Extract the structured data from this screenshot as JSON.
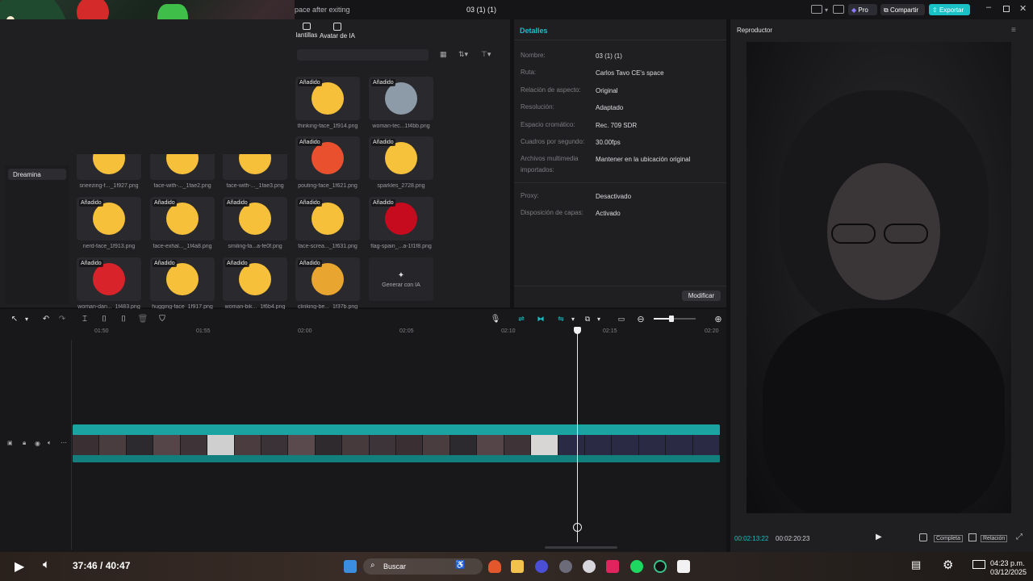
{
  "title_bar": {
    "left_text": "pace after exiting",
    "project_name": "03 (1) (1)",
    "pro_label": "Pro",
    "share_label": "Compartir",
    "export_label": "Exportar",
    "accent_color": "#19c0c6"
  },
  "media_panel": {
    "tabs": [
      {
        "label": "lantillas",
        "icon": "template-icon"
      },
      {
        "label": "Avatar de IA",
        "icon": "avatar-icon"
      }
    ],
    "sidebar": {
      "active_item": "Dreamina"
    },
    "badge_label": "Añadido",
    "items": [
      {
        "caption": "thinking-face_1f914.png",
        "icon": "thinking-face-icon",
        "color": "#f6c03a"
      },
      {
        "caption": "woman-tec...1f4bb.png",
        "icon": "woman-technologist-icon",
        "color": "#8d9aa8"
      },
      {
        "caption": "pouting-face_1f621.png",
        "icon": "pouting-face-icon",
        "color": "#e8502e"
      },
      {
        "caption": "sparkles_2728.png",
        "icon": "sparkles-icon",
        "color": "#f7c23b"
      },
      {
        "caption": "sneezing-f..._1f927.png",
        "icon": "sneezing-face-icon",
        "color": "#f6c03a"
      },
      {
        "caption": "face-with-..._1fae2.png",
        "icon": "face-with-hand-icon",
        "color": "#f6c03a"
      },
      {
        "caption": "face-with-..._1fae3.png",
        "icon": "face-peeking-icon",
        "color": "#f6c03a"
      },
      {
        "caption": "nerd-face_1f913.png",
        "icon": "nerd-face-icon",
        "color": "#f6c03a"
      },
      {
        "caption": "face-exhal..._1f4a8.png",
        "icon": "face-exhaling-icon",
        "color": "#f6c03a"
      },
      {
        "caption": "smiling-fa...a-fe0f.png",
        "icon": "smiling-face-icon",
        "color": "#f6c03a"
      },
      {
        "caption": "face-screa..._1f631.png",
        "icon": "face-screaming-icon",
        "color": "#f6c03a"
      },
      {
        "caption": "flag-spain_...a-1f1f8.png",
        "icon": "flag-spain-icon",
        "color": "#c60b1e"
      },
      {
        "caption": "woman-dan..._1f483.png",
        "icon": "woman-dancing-icon",
        "color": "#d8232a"
      },
      {
        "caption": "hugging-face_1f917.png",
        "icon": "hugging-face-icon",
        "color": "#f6c03a"
      },
      {
        "caption": "woman-bik..._1f6b4.png",
        "icon": "woman-biking-icon",
        "color": "#f6c03a"
      },
      {
        "caption": "clinking-be..._1f37b.png",
        "icon": "clinking-beer-icon",
        "color": "#e8a530"
      }
    ],
    "generate_label": "Generar con IA"
  },
  "details": {
    "title": "Detalles",
    "rows": [
      {
        "label": "Nombre:",
        "value": "03 (1) (1)"
      },
      {
        "label": "Ruta:",
        "value": "Carlos Tavo CE's space"
      },
      {
        "label": "Relación de aspecto:",
        "value": "Original"
      },
      {
        "label": "Resolución:",
        "value": "Adaptado"
      },
      {
        "label": "Espacio cromático:",
        "value": "Rec. 709 SDR"
      },
      {
        "label": "Cuadros por segundo:",
        "value": "30.00fps"
      },
      {
        "label": "Archivos multimedia importados:",
        "value": "Mantener en la ubicación original"
      },
      {
        "label": "Proxy:",
        "value": "Desactivado"
      },
      {
        "label": "Disposición de capas:",
        "value": "Activado"
      }
    ],
    "modify_label": "Modificar"
  },
  "player": {
    "title": "Reproductor",
    "current_time": "00:02:13:22",
    "total_time": "00:02:20:23",
    "full_label": "Completa",
    "ratio_label": "Relación"
  },
  "timeline": {
    "ticks": [
      "01:50",
      "01:55",
      "02:00",
      "02:05",
      "02:10",
      "02:15",
      "02:20"
    ],
    "clip_color": "#1aa3a0"
  },
  "bottom": {
    "time_display": "37:46 / 40:47",
    "search_placeholder": "Buscar",
    "clock_time": "04:23 p.m.",
    "clock_date": "03/12/2025"
  }
}
